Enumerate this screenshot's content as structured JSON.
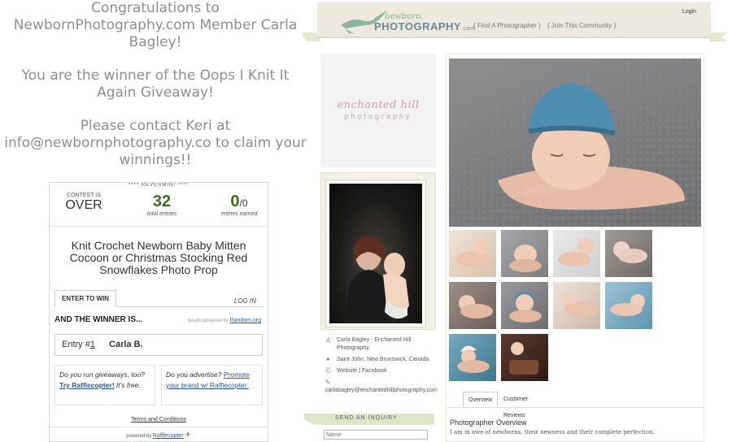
{
  "announcement": {
    "line1": "Congratulations to NewbornPhotography.com Member Carla Bagley!",
    "line2": "You are the winner of the Oops I Knit It Again Giveaway!",
    "line3": "Please contact Keri at info@newbornphotography.co to claim your winnings!!"
  },
  "rafflecopter": {
    "top_strip": "**** REVERMIN! ****",
    "contest_label": "CONTEST IS",
    "contest_status": "OVER",
    "total_entries": "32",
    "total_entries_label": "total entries",
    "entries_earned": "0",
    "entries_earned_of": "/0",
    "entries_earned_label": "entries earned",
    "prize_title": "Knit Crochet Newborn Baby Mitten Cocoon or Christmas Stocking Red Snowflakes Photo Prop",
    "tab_enter": "ENTER TO WIN",
    "tab_login": "LOG IN",
    "winner_heading": "AND THE WINNER IS...",
    "results_powered": "results powered by",
    "results_provider": "Random.org",
    "entry_prefix": "Entry #",
    "entry_number": "1",
    "winner_name": "Carla B.",
    "ad1_text": "Do you run giveaways, too?",
    "ad1_link": "Try Rafflecopter!",
    "ad1_tail": "It's free.",
    "ad2_text": "Do you advertise?",
    "ad2_link": "Promote your brand w/ Rafflecopter.",
    "terms": "Terms and Conditions",
    "powered_by": "powered by",
    "brand": "Rafflecopter"
  },
  "site": {
    "logo_top": "newborn",
    "logo_main": "PHOTOGRAPHY",
    "logo_suffix": ".com",
    "nav_find": "{ Find A Photographer }",
    "nav_join": "{ Join This Community }",
    "login": "Login",
    "studio_logo": "enchanted hill",
    "studio_logo_sub": "photography",
    "info": {
      "name": "Carla Bagley - Enchanted Hill Photography",
      "location": "Saint John, New Brunswick, Canada",
      "website": "Website",
      "separator": "|",
      "facebook": "Facebook",
      "email": "carlabagley@enchantedhillphotography.com"
    },
    "inquiry": "SEND AN INQUIRY",
    "name_placeholder": "Name",
    "tabs": {
      "overview": "Overview",
      "reviews": "Customer Reviews"
    },
    "overview_heading": "Photographer Overview",
    "overview_text": "I am in awe of newborns, their newness and their complete perfection."
  },
  "colors": {
    "announce_text": "#8e8e8e",
    "green_count": "#3c6f1b",
    "link_blue": "#2a5a9c",
    "header_bg": "#ede9de",
    "ribbon": "#e2e9ce",
    "studio_pink": "#c4a2a7"
  }
}
